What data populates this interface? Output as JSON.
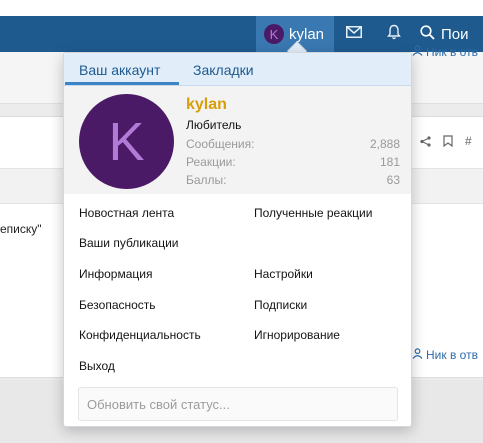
{
  "navbar": {
    "user_initial": "K",
    "username": "kylan",
    "search_label": "Пои"
  },
  "background": {
    "quote_text": "еписку\"",
    "nick_text": "Ник в отв"
  },
  "popup": {
    "tabs": [
      "Ваш аккаунт",
      "Закладки"
    ],
    "profile": {
      "initial": "K",
      "username": "kylan",
      "user_title": "Любитель",
      "stats": [
        {
          "label": "Сообщения:",
          "value": "2,888"
        },
        {
          "label": "Реакции:",
          "value": "181"
        },
        {
          "label": "Баллы:",
          "value": "63"
        }
      ]
    },
    "links": {
      "newsfeed": "Новостная лента",
      "received_reactions": "Полученные реакции",
      "your_posts": "Ваши публикации",
      "info": "Информация",
      "settings": "Настройки",
      "security": "Безопасность",
      "subscriptions": "Подписки",
      "privacy": "Конфиденциальность",
      "ignoring": "Игнорирование",
      "logout": "Выход"
    },
    "status_placeholder": "Обновить свой статус..."
  },
  "colors": {
    "navbar": "#1f5a8f",
    "username_accent": "#d89e0a",
    "avatar_bg": "#4b1a66",
    "tab_active_underline": "#3d84c6"
  }
}
